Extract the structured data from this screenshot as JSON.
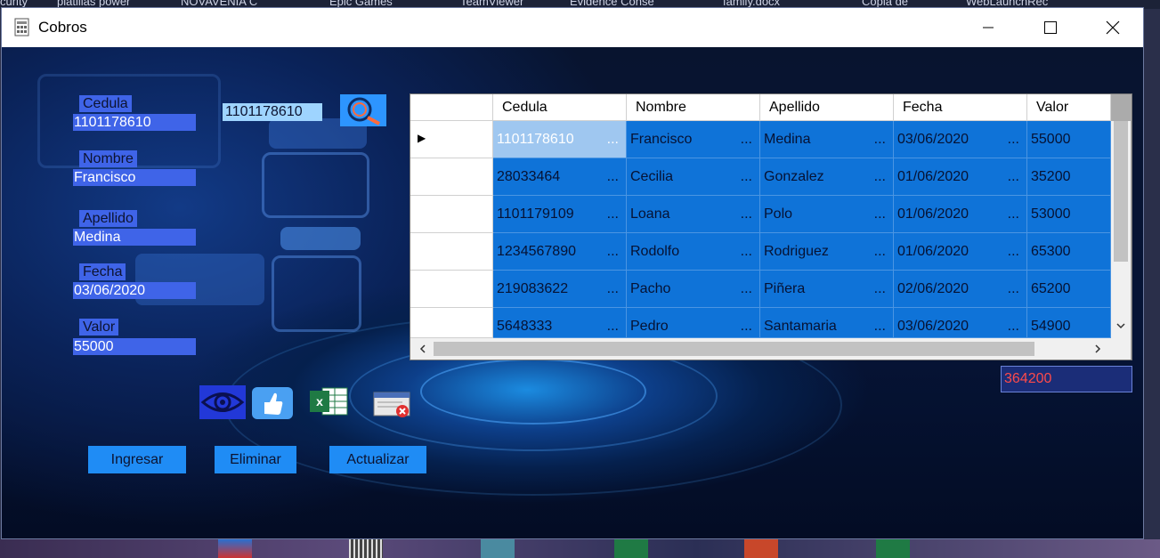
{
  "desktop": {
    "top_items": [
      "curity",
      "platillas power",
      "NOVAVENIA C",
      "Epic Games",
      "TeamViewer",
      "Evidence Conse",
      "family.docx",
      "Copia de",
      "WebLaunchRec"
    ]
  },
  "window": {
    "title": "Cobros",
    "controls": {
      "minimize": "minimize",
      "maximize": "maximize",
      "close": "close"
    }
  },
  "form": {
    "cedula": {
      "label": "Cedula",
      "value": "1101178610"
    },
    "nombre": {
      "label": "Nombre",
      "value": "Francisco"
    },
    "apellido": {
      "label": "Apellido",
      "value": "Medina"
    },
    "fecha": {
      "label": "Fecha",
      "value": "03/06/2020"
    },
    "valor": {
      "label": "Valor",
      "value": "55000"
    },
    "search_value": "1101178610"
  },
  "icons": [
    "search-icon",
    "eye-icon",
    "thumbs-up-icon",
    "excel-icon",
    "report-delete-icon"
  ],
  "actions": {
    "ingresar": "Ingresar",
    "eliminar": "Eliminar",
    "actualizar": "Actualizar"
  },
  "total": "364200",
  "grid": {
    "columns": [
      "Cedula",
      "Nombre",
      "Apellido",
      "Fecha",
      "Valor"
    ],
    "rows": [
      [
        "1101178610",
        "Francisco",
        "Medina",
        "03/06/2020",
        "55000"
      ],
      [
        "28033464",
        "Cecilia",
        "Gonzalez",
        "01/06/2020",
        "35200"
      ],
      [
        "1101179109",
        "Loana",
        "Polo",
        "01/06/2020",
        "53000"
      ],
      [
        "1234567890",
        "Rodolfo",
        "Rodriguez",
        "01/06/2020",
        "65300"
      ],
      [
        "219083622",
        "Pacho",
        "Piñera",
        "02/06/2020",
        "65200"
      ],
      [
        "5648333",
        "Pedro",
        "Santamaria",
        "03/06/2020",
        "54900"
      ]
    ],
    "ellipsis": "...",
    "current_row_marker": "▶"
  },
  "colors": {
    "field_bg": "#3f64e8",
    "button_bg": "#1f8cf5",
    "grid_cell": "#0f73d8",
    "total_text": "#ff4a4a"
  }
}
